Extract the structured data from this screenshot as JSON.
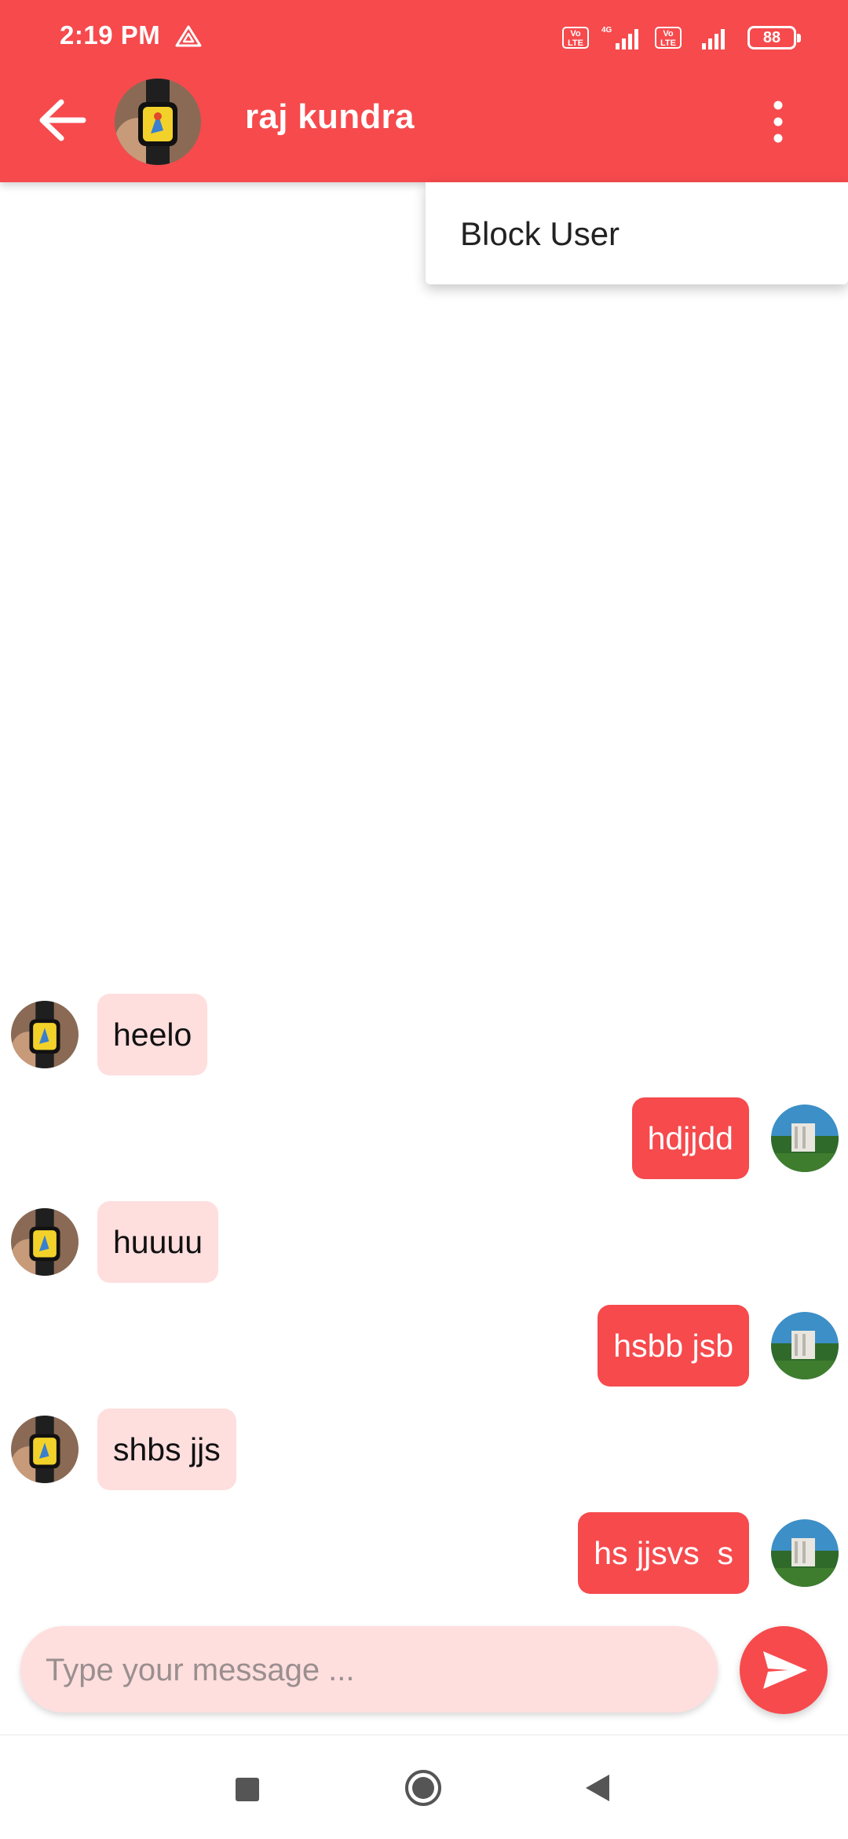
{
  "status_bar": {
    "time": "2:19 PM",
    "network": "4G",
    "volte_label": "Vo\nLTE",
    "battery": "88"
  },
  "header": {
    "contact_name": "raj kundra",
    "icons": [
      "back-arrow-icon",
      "more-vert-icon"
    ]
  },
  "menu": {
    "items": [
      {
        "label": "Block User"
      }
    ]
  },
  "messages": [
    {
      "side": "in",
      "text": "heelo"
    },
    {
      "side": "out",
      "text": "hdjjdd"
    },
    {
      "side": "in",
      "text": "huuuu"
    },
    {
      "side": "out",
      "text": "hsbb jsb"
    },
    {
      "side": "in",
      "text": "shbs jjs"
    },
    {
      "side": "out",
      "text": "hs jjsvs  s"
    }
  ],
  "composer": {
    "placeholder": "Type your message ..."
  },
  "colors": {
    "primary": "#f64a4d",
    "incoming_bubble": "#ffdede",
    "composer_bg": "#ffdede"
  }
}
